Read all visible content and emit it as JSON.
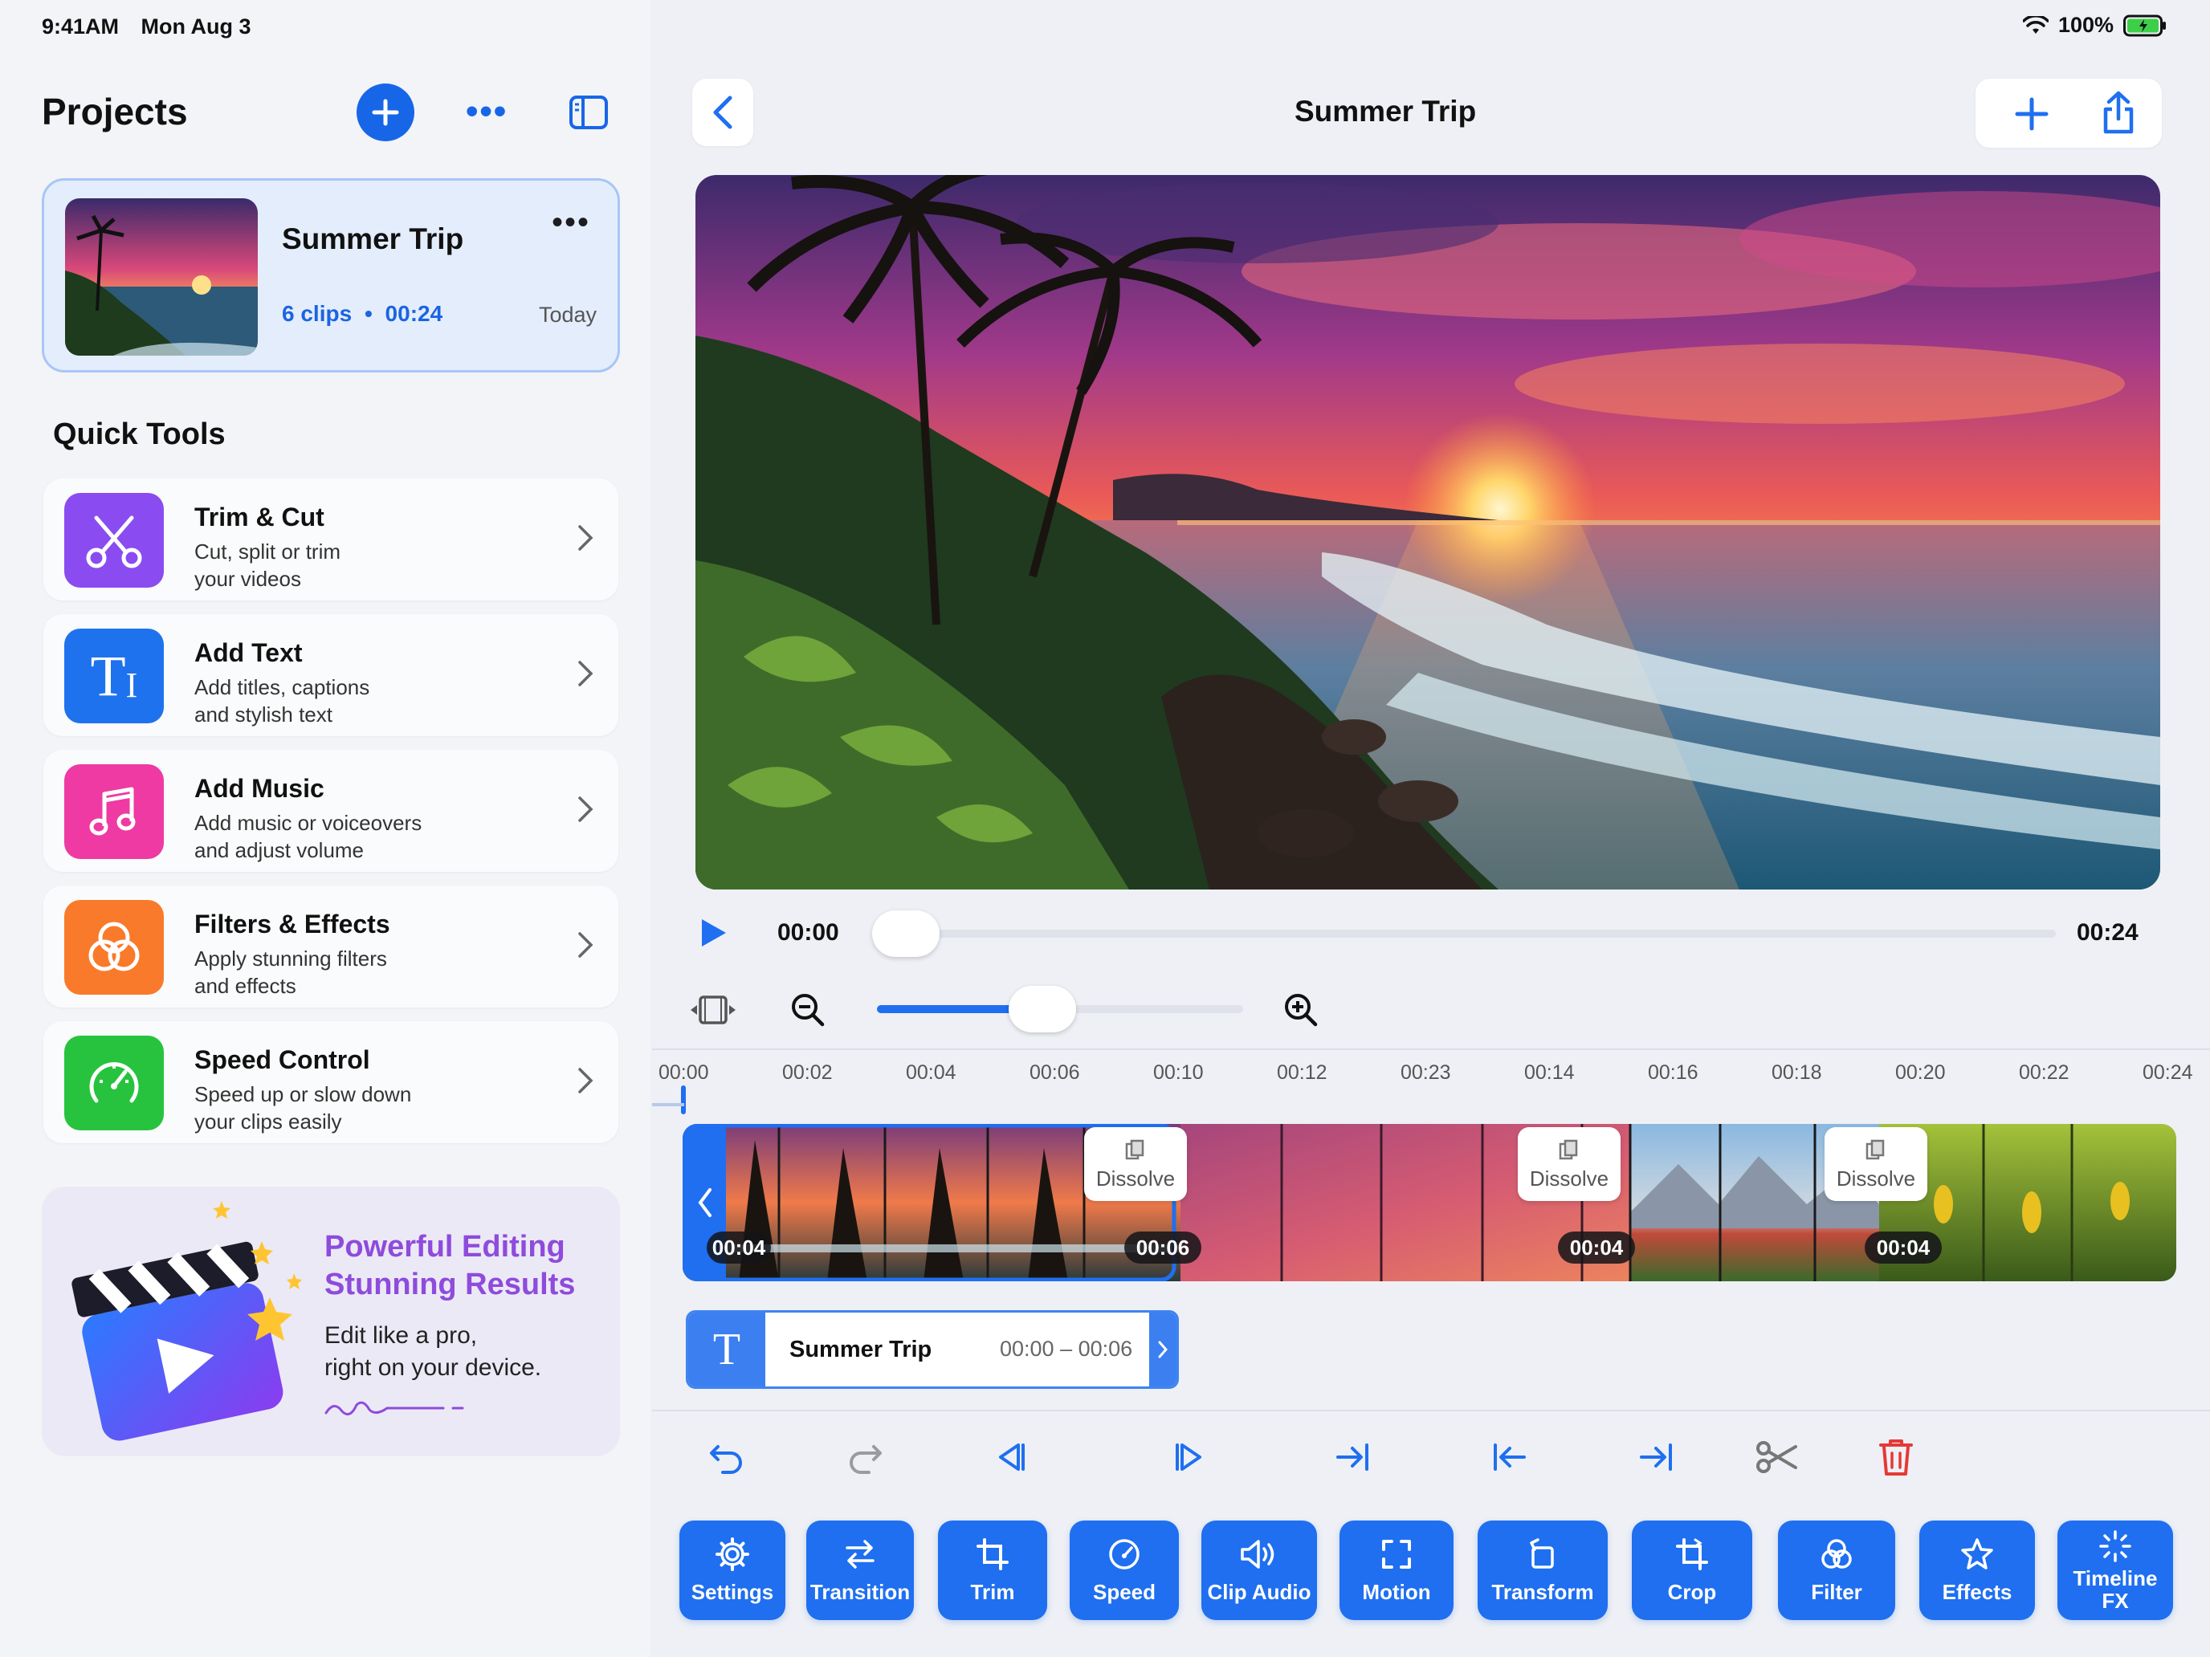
{
  "status": {
    "time": "9:41AM",
    "date": "Mon Aug 3",
    "battery": "100%"
  },
  "sidebar": {
    "title": "Projects",
    "project": {
      "name": "Summer Trip",
      "clips": "6 clips",
      "separator": "•",
      "duration": "00:24",
      "date": "Today"
    },
    "section_title": "Quick Tools",
    "tools": [
      {
        "title": "Trim & Cut",
        "desc1": "Cut, split or trim",
        "desc2": "your videos",
        "icon": "scissors-icon",
        "color": "#8a4cf0"
      },
      {
        "title": "Add Text",
        "desc1": "Add titles, captions",
        "desc2": "and stylish text",
        "icon": "text-icon",
        "color": "#1f72ee"
      },
      {
        "title": "Add Music",
        "desc1": "Add music or voiceovers",
        "desc2": "and adjust volume",
        "icon": "music-note-icon",
        "color": "#ee3aa2"
      },
      {
        "title": "Filters & Effects",
        "desc1": "Apply stunning filters",
        "desc2": "and effects",
        "icon": "filter-icon",
        "color": "#f97a2a"
      },
      {
        "title": "Speed Control",
        "desc1": "Speed up or slow down",
        "desc2": "your clips easily",
        "icon": "speedometer-icon",
        "color": "#27c33e"
      }
    ],
    "promo": {
      "title1": "Powerful Editing",
      "title2": "Stunning Results",
      "text1": "Edit like a pro,",
      "text2": "right on your device."
    }
  },
  "main": {
    "title": "Summer Trip",
    "player": {
      "current": "00:00",
      "total": "00:24",
      "progress": 0.0
    },
    "zoom_level": 0.4,
    "ruler": [
      "00:00",
      "00:02",
      "00:04",
      "00:06",
      "00:10",
      "00:12",
      "00:23",
      "00:14",
      "00:16",
      "00:18",
      "00:20",
      "00:22",
      "00:24"
    ],
    "timeline": {
      "transitions": [
        {
          "label": "Dissolve",
          "duration": "00:06"
        },
        {
          "label": "Dissolve",
          "duration": "00:04"
        },
        {
          "label": "Dissolve",
          "duration": "00:04"
        }
      ],
      "first_clip_duration": "00:04"
    },
    "text_track": {
      "name": "Summer Trip",
      "range": "00:00 – 00:06",
      "glyph": "T"
    },
    "toolbar": [
      "Settings",
      "Transition",
      "Trim",
      "Speed",
      "Clip Audio",
      "Motion",
      "Transform",
      "Crop",
      "Filter",
      "Effects",
      "Timeline FX"
    ]
  },
  "colors": {
    "accent": "#1f6ff0",
    "promo_purple": "#8e4bdc",
    "delete": "#e53935"
  }
}
